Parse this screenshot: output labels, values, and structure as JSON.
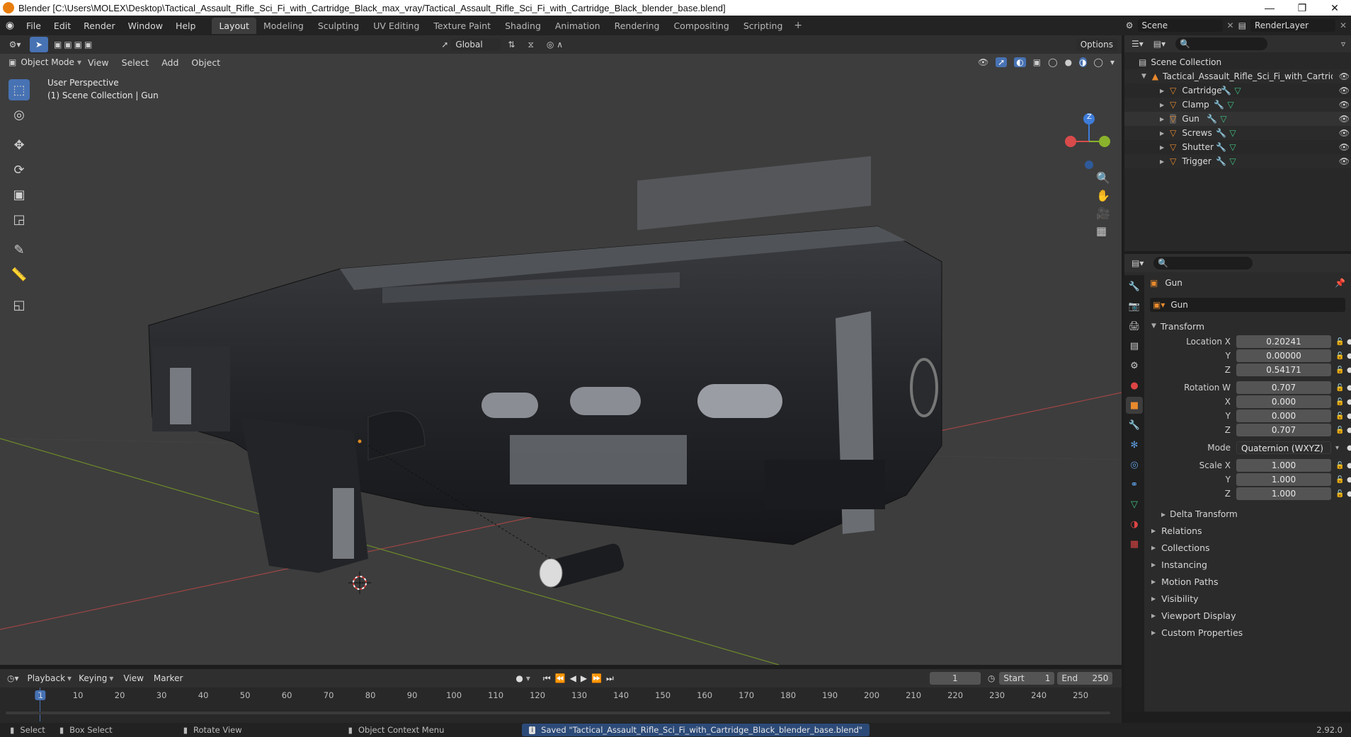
{
  "window": {
    "title": "Blender [C:\\Users\\MOLEX\\Desktop\\Tactical_Assault_Rifle_Sci_Fi_with_Cartridge_Black_max_vray/Tactical_Assault_Rifle_Sci_Fi_with_Cartridge_Black_blender_base.blend]"
  },
  "menu": [
    "File",
    "Edit",
    "Render",
    "Window",
    "Help"
  ],
  "workspaces": [
    "Layout",
    "Modeling",
    "Sculpting",
    "UV Editing",
    "Texture Paint",
    "Shading",
    "Animation",
    "Rendering",
    "Compositing",
    "Scripting"
  ],
  "active_workspace": "Layout",
  "scene_field": "Scene",
  "layer_field": "RenderLayer",
  "viewport": {
    "mode": "Object Mode",
    "menus": [
      "View",
      "Select",
      "Add",
      "Object"
    ],
    "orientation": "Global",
    "options_label": "Options",
    "overlay_line1": "User Perspective",
    "overlay_line2": "(1) Scene Collection | Gun",
    "gizmo_z": "Z"
  },
  "outliner": {
    "root": "Scene Collection",
    "collection": "Tactical_Assault_Rifle_Sci_Fi_with_Cartridge",
    "objects": [
      "Cartridge",
      "Clamp",
      "Gun",
      "Screws",
      "Shutter",
      "Trigger"
    ]
  },
  "properties": {
    "object_name": "Gun",
    "data_name": "Gun",
    "transform_label": "Transform",
    "location": {
      "label": "Location X",
      "x": "0.20241",
      "y": "0.00000",
      "z": "0.54171"
    },
    "rotation": {
      "label": "Rotation W",
      "w": "0.707",
      "x": "0.000",
      "y": "0.000",
      "z": "0.707"
    },
    "mode_label": "Mode",
    "mode_value": "Quaternion (WXYZ)",
    "scale": {
      "label": "Scale X",
      "x": "1.000",
      "y": "1.000",
      "z": "1.000"
    },
    "axis_y": "Y",
    "axis_z": "Z",
    "axis_x": "X",
    "delta": "Delta Transform",
    "panels": [
      "Relations",
      "Collections",
      "Instancing",
      "Motion Paths",
      "Visibility",
      "Viewport Display",
      "Custom Properties"
    ]
  },
  "timeline": {
    "menus": [
      "Playback",
      "Keying",
      "View",
      "Marker"
    ],
    "current_frame": "1",
    "start_label": "Start",
    "start_value": "1",
    "end_label": "End",
    "end_value": "250",
    "ruler_marks": [
      "1",
      "10",
      "20",
      "30",
      "40",
      "50",
      "60",
      "70",
      "80",
      "90",
      "100",
      "110",
      "120",
      "130",
      "140",
      "150",
      "160",
      "170",
      "180",
      "190",
      "200",
      "210",
      "220",
      "230",
      "240",
      "250"
    ]
  },
  "status": {
    "select": "Select",
    "box_select": "Box Select",
    "rotate_view": "Rotate View",
    "context_menu": "Object Context Menu",
    "message": "Saved \"Tactical_Assault_Rifle_Sci_Fi_with_Cartridge_Black_blender_base.blend\"",
    "version": "2.92.0"
  },
  "colors": {
    "accent": "#4772b3",
    "x_axis": "#d94b4b",
    "y_axis": "#8ab22c",
    "z_axis": "#3d7cd9"
  }
}
